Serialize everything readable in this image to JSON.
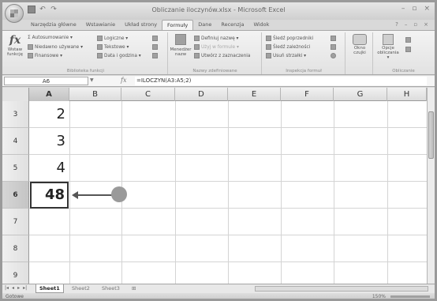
{
  "window": {
    "title": "Obliczanie iloczynów.xlsx - Microsoft Excel",
    "qat_save_icon": "save-icon",
    "qat_undo": "↶",
    "qat_redo": "↷",
    "minimize": "–",
    "restore": "▫",
    "close": "×"
  },
  "tabs": [
    {
      "label": "Narzędzia główne"
    },
    {
      "label": "Wstawianie"
    },
    {
      "label": "Układ strony"
    },
    {
      "label": "Formuły"
    },
    {
      "label": "Dane"
    },
    {
      "label": "Recenzja"
    },
    {
      "label": "Widok"
    }
  ],
  "active_tab_index": 3,
  "ribbon": {
    "library": {
      "insert_function": "Wstaw funkcję",
      "autosum": "Autosumowanie ▾",
      "recent": "Niedawno używane ▾",
      "financial": "Finansowe ▾",
      "logical": "Logiczne ▾",
      "text": "Tekstowe ▾",
      "datetime": "Data i godzina ▾",
      "label": "Biblioteka funkcji"
    },
    "names": {
      "manager": "Menedżer nazw",
      "define": "Definiuj nazwę ▾",
      "use_in_formula": "Użyj w formule ▾",
      "create_from_selection": "Utwórz z zaznaczenia",
      "label": "Nazwy zdefiniowane"
    },
    "audit": {
      "trace_precedents": "Śledź poprzedniki",
      "trace_dependents": "Śledź zależności",
      "remove_arrows": "Usuń strzałki ▾",
      "label": "Inspekcja formuł"
    },
    "watch": {
      "label": "Okno czujki"
    },
    "calc": {
      "options": "Opcje obliczania ▾",
      "label": "Obliczanie"
    }
  },
  "formula_bar": {
    "name_box": "A6",
    "fx": "fx",
    "formula": "=ILOCZYN(A3:A5;2)"
  },
  "columns": [
    "A",
    "B",
    "C",
    "D",
    "E",
    "F",
    "G",
    "H"
  ],
  "rows": [
    {
      "num": "3",
      "a": "2"
    },
    {
      "num": "4",
      "a": "3"
    },
    {
      "num": "5",
      "a": "4"
    },
    {
      "num": "6",
      "a": "48"
    },
    {
      "num": "7",
      "a": ""
    },
    {
      "num": "8",
      "a": ""
    },
    {
      "num": "9",
      "a": ""
    }
  ],
  "sheets": [
    "Sheet1",
    "Sheet2",
    "Sheet3"
  ],
  "status": {
    "ready": "Gotowe",
    "zoom": "150%"
  },
  "colors": {
    "accent": "#555555",
    "dot": "#9a9a9a"
  }
}
